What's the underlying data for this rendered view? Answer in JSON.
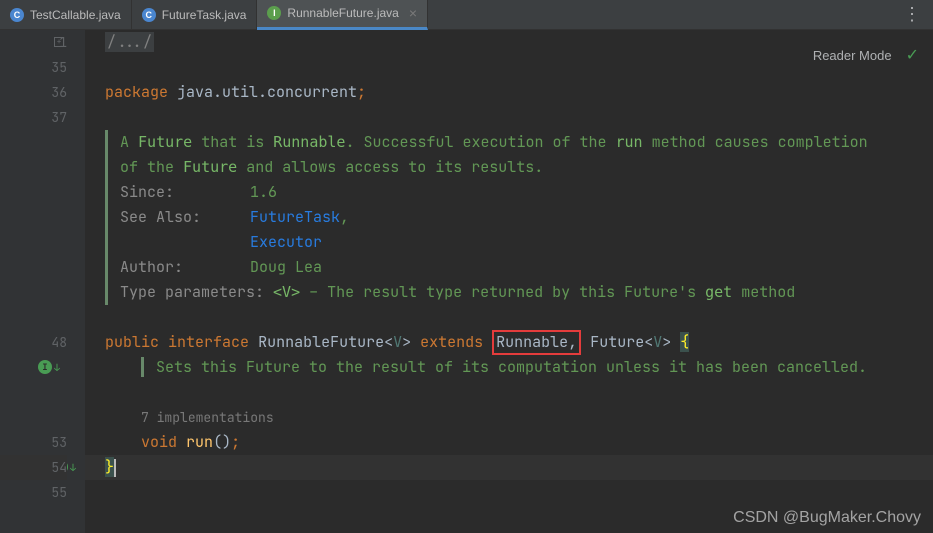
{
  "tabs": [
    {
      "label": "TestCallable.java",
      "icon": "C",
      "iconClass": "icon-class"
    },
    {
      "label": "FutureTask.java",
      "icon": "C",
      "iconClass": "icon-class"
    },
    {
      "label": "RunnableFuture.java",
      "icon": "I",
      "iconClass": "icon-interface"
    }
  ],
  "reader_mode": "Reader Mode",
  "gutter": {
    "l1": "1",
    "l35": "35",
    "l36": "36",
    "l37": "37",
    "l48": "48",
    "l53": "53",
    "l54": "54",
    "l55": "55"
  },
  "code": {
    "fold": "/.../",
    "pkg_kw": "package",
    "pkg": "java.util.concurrent",
    "doc1a": "A ",
    "doc1b": "Future",
    "doc1c": " that is ",
    "doc1d": "Runnable",
    "doc1e": ". Successful execution of the ",
    "doc1f": "run",
    "doc1g": " method causes completion",
    "doc2a": "of the ",
    "doc2b": "Future",
    "doc2c": " and allows access to its results.",
    "since_label": "Since:",
    "since_val": "1.6",
    "see_label": "See Also:",
    "see_val1": "FutureTask",
    "see_val2": "Executor",
    "author_label": "Author:",
    "author_val": "Doug Lea",
    "tp_label": "Type parameters: ",
    "tp_val": "<V>",
    "tp_desc": " – The result type returned by this Future's ",
    "tp_get": "get",
    "tp_end": " method",
    "public": "public",
    "interface_kw": "interface",
    "iface_name": "RunnableFuture",
    "generic_v": "V",
    "extends": "extends",
    "runnable": "Runnable",
    "future": "Future",
    "brace_open": "{",
    "sets_doc": "Sets this Future to the result of its computation unless it has been cancelled.",
    "impl_hint": "7 implementations",
    "void": "void",
    "run": "run",
    "brace_close": "}"
  },
  "watermark": "CSDN @BugMaker.Chovy"
}
